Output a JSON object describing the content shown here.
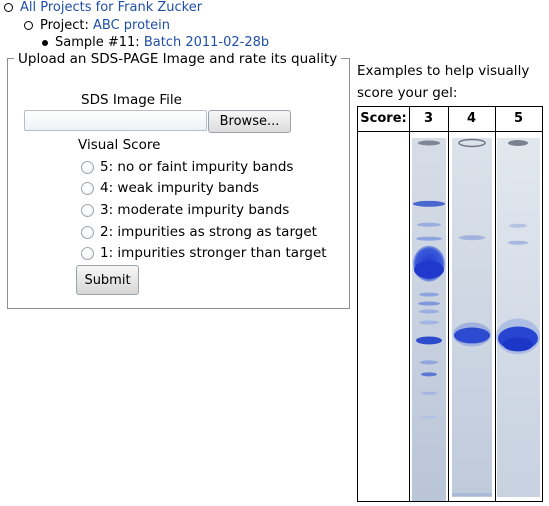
{
  "breadcrumb": {
    "root_link": "All Projects for Frank Zucker",
    "project_label": "Project: ",
    "project_link": "ABC protein",
    "sample_label": "Sample #11: ",
    "sample_link": "Batch 2011-02-28b"
  },
  "upload_form": {
    "legend": "Upload an SDS-PAGE Image and rate its quality",
    "file_label": "SDS Image File",
    "browse_label": "Browse...",
    "score_label": "Visual Score",
    "options": [
      {
        "label": "5: no or faint impurity bands"
      },
      {
        "label": "4: weak impurity bands"
      },
      {
        "label": "3: moderate impurity bands"
      },
      {
        "label": "2: impurities as strong as target"
      },
      {
        "label": "1: impurities stronger than target"
      }
    ],
    "submit_label": "Submit"
  },
  "examples": {
    "intro": "Examples to help visually score your gel:",
    "header_label": "Score:",
    "columns": [
      "3",
      "4",
      "5"
    ]
  },
  "colors": {
    "link": "#1f4fa6",
    "gel_background": "#c8d2e2",
    "band_blue": "#2c46c8"
  }
}
